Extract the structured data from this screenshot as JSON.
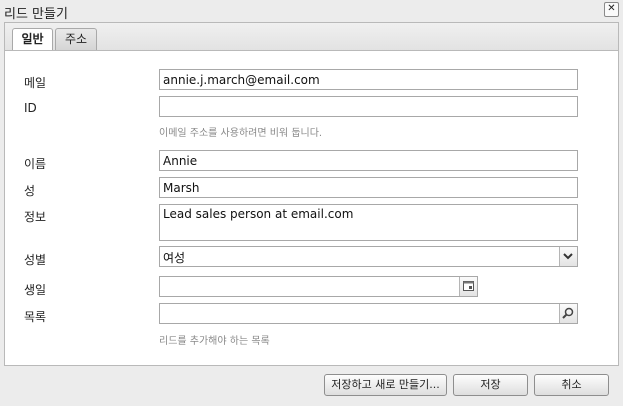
{
  "window": {
    "title": "리드 만들기",
    "close_label": "✕"
  },
  "tabs": [
    {
      "label": "일반",
      "active": true
    },
    {
      "label": "주소",
      "active": false
    }
  ],
  "form": {
    "email": {
      "label": "메일",
      "value": "annie.j.march@email.com"
    },
    "id": {
      "label": "ID",
      "value": "",
      "help": "이메일 주소를 사용하려면 비워 둡니다."
    },
    "first_name": {
      "label": "이름",
      "value": "Annie"
    },
    "last_name": {
      "label": "성",
      "value": "Marsh"
    },
    "info": {
      "label": "정보",
      "value": "Lead sales person at email.com"
    },
    "gender": {
      "label": "성별",
      "value": "여성"
    },
    "birthday": {
      "label": "생일",
      "value": ""
    },
    "list": {
      "label": "목록",
      "value": "",
      "help": "리드를 추가해야 하는 목록"
    }
  },
  "buttons": {
    "save_new": "저장하고 새로 만들기...",
    "save": "저장",
    "cancel": "취소"
  }
}
